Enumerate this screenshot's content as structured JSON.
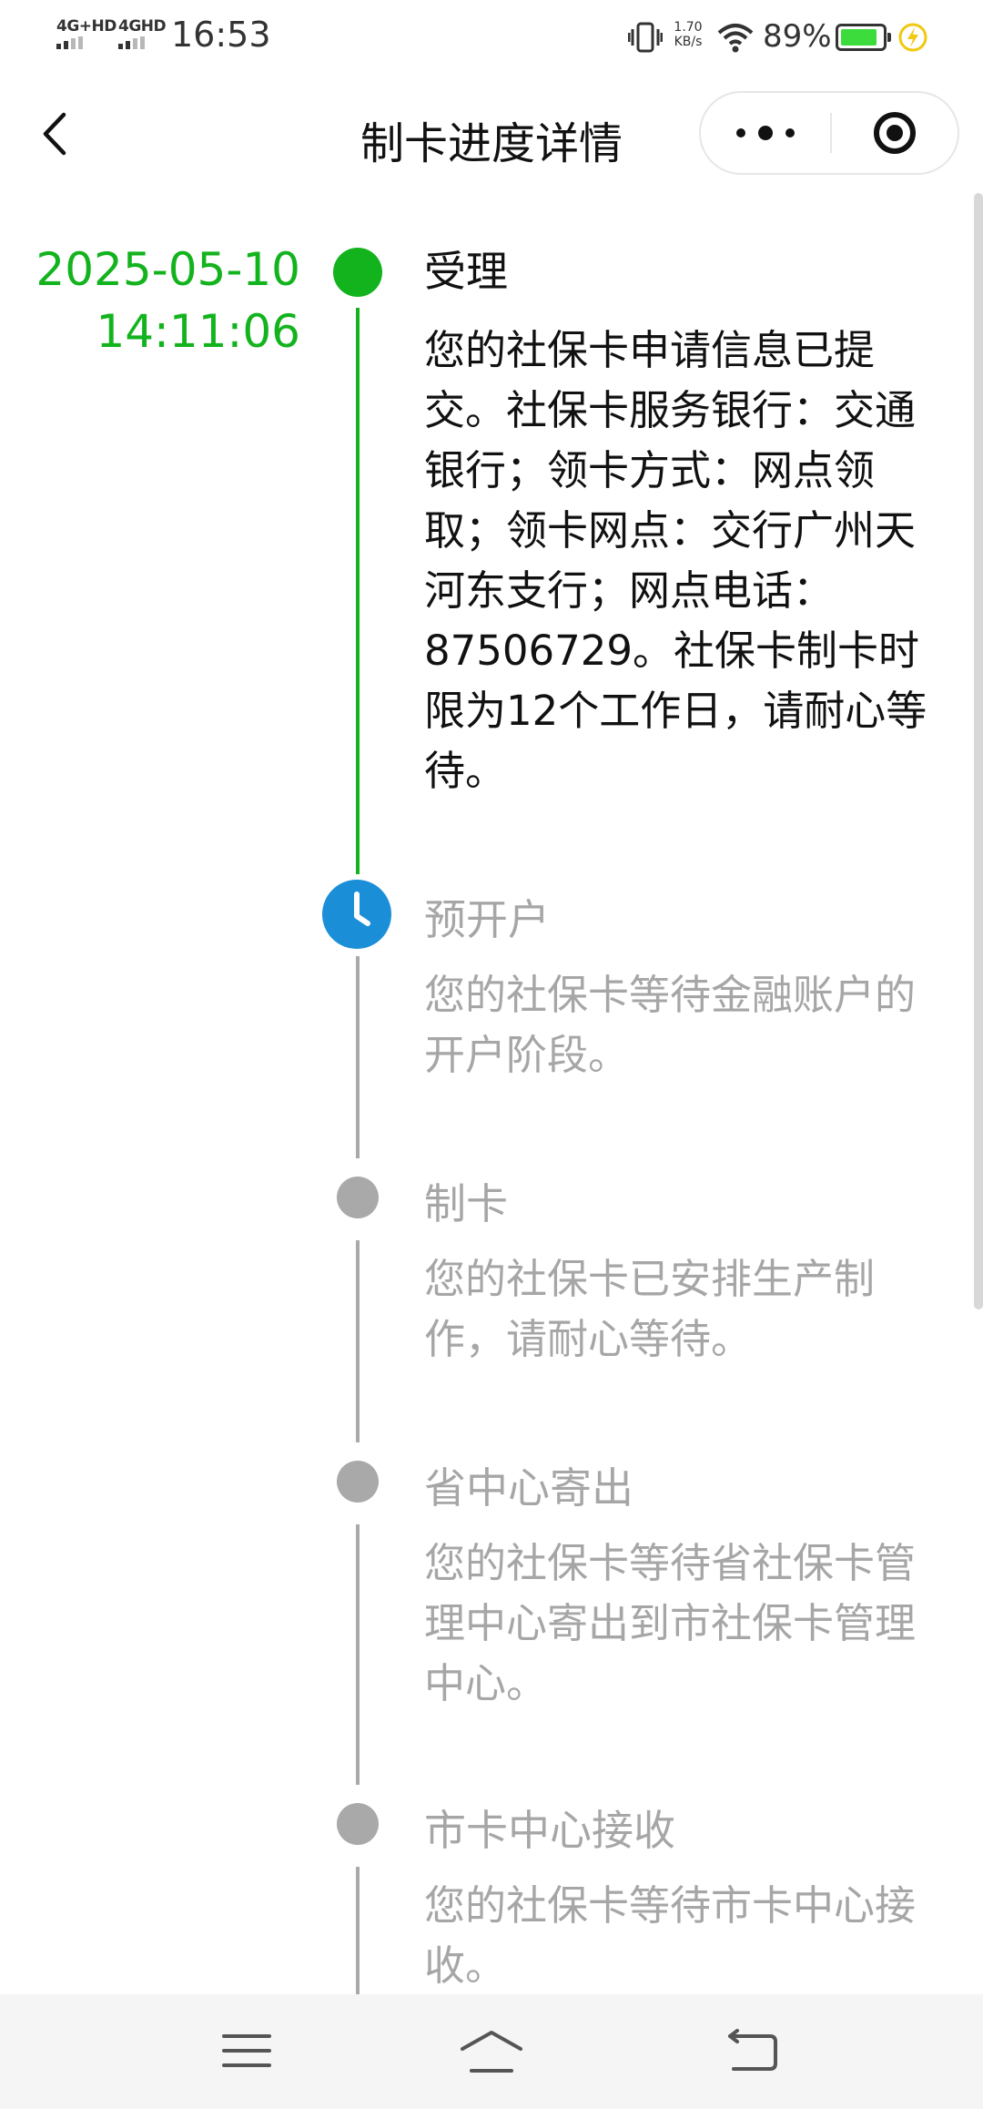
{
  "status_bar": {
    "sim1_label": "4G+HD",
    "sim2_label": "4GHD",
    "time": "16:53",
    "net_speed_value": "1.70",
    "net_speed_unit": "KB/s",
    "battery_percent": "89%",
    "battery_level": 0.89,
    "icons": [
      "signal-icon",
      "vibrate-icon",
      "wifi-icon",
      "battery-icon",
      "charging-icon"
    ]
  },
  "nav": {
    "title": "制卡进度详情",
    "icons": [
      "back-icon",
      "more-icon",
      "close-miniprogram-icon"
    ]
  },
  "timeline": {
    "date": "2025-05-10",
    "time": "14:11:06",
    "steps": [
      {
        "title": "受理",
        "desc": "您的社保卡申请信息已提交。社保卡服务银行：交通银行；领卡方式：网点领取；领卡网点：交行广州天河东支行；网点电话：87506729。社保卡制卡时限为12个工作日，请耐心等待。",
        "status": "done"
      },
      {
        "title": "预开户",
        "desc": "您的社保卡等待金融账户的开户阶段。",
        "status": "in-progress"
      },
      {
        "title": "制卡",
        "desc": "您的社保卡已安排生产制作，请耐心等待。",
        "status": "pending"
      },
      {
        "title": "省中心寄出",
        "desc": "您的社保卡等待省社保卡管理中心寄出到市社保卡管理中心。",
        "status": "pending"
      },
      {
        "title": "市卡中心接收",
        "desc": "您的社保卡等待市卡中心接收。",
        "status": "pending"
      }
    ]
  },
  "colors": {
    "done": "#13b31e",
    "in_progress": "#1a8fd8",
    "pending": "#a9a9a9"
  },
  "bottom_nav": {
    "icons": [
      "menu-icon",
      "home-icon",
      "back-nav-icon"
    ]
  }
}
